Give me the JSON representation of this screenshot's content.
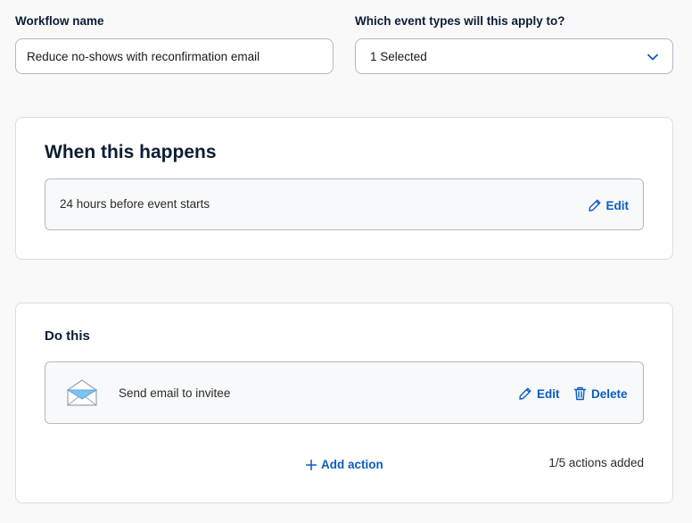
{
  "workflow_name": {
    "label": "Workflow name",
    "value": "Reduce no-shows with reconfirmation email"
  },
  "event_types": {
    "label": "Which event types will this apply to?",
    "selected": "1 Selected"
  },
  "trigger": {
    "title": "When this happens",
    "description": "24 hours before event starts",
    "edit_label": "Edit"
  },
  "actions": {
    "title": "Do this",
    "items": [
      {
        "label": "Send email to invitee",
        "icon": "envelope-icon",
        "edit_label": "Edit",
        "delete_label": "Delete"
      }
    ],
    "add_label": "Add action",
    "count_text": "1/5 actions added"
  },
  "colors": {
    "link": "#0a5cc0",
    "heading": "#0b1d34",
    "border": "#b2b9c4",
    "envelope_fill": "#7cc3f2"
  }
}
